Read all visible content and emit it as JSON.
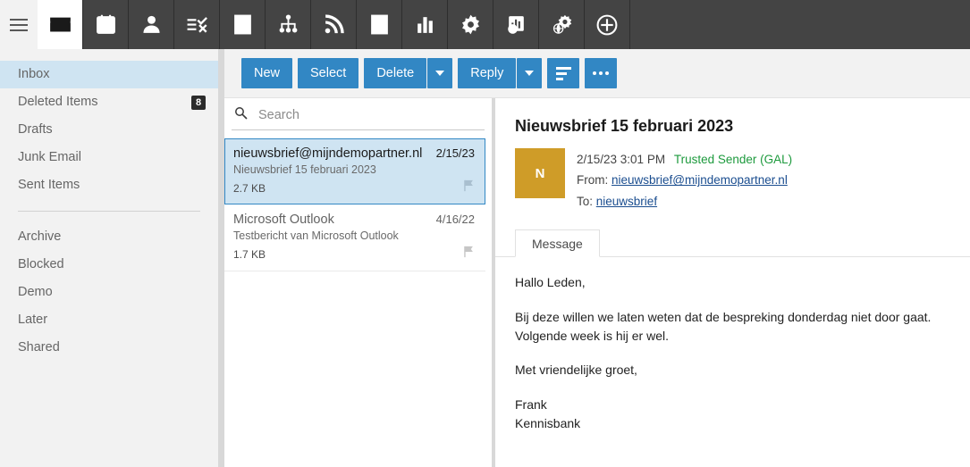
{
  "topnav": {
    "menu_icon": "hamburger-icon",
    "items": [
      {
        "icon": "mail-icon",
        "label": "Mail",
        "active": true
      },
      {
        "icon": "calendar-icon",
        "label": "Calendar",
        "active": false
      },
      {
        "icon": "contacts-icon",
        "label": "Contacts",
        "active": false
      },
      {
        "icon": "tasks-icon",
        "label": "Tasks",
        "active": false
      },
      {
        "icon": "notes-icon",
        "label": "Notes",
        "active": false
      },
      {
        "icon": "org-chart-icon",
        "label": "Organization",
        "active": false
      },
      {
        "icon": "rss-feed-icon",
        "label": "Feeds",
        "active": false
      },
      {
        "icon": "inbox-down-icon",
        "label": "Archive",
        "active": false
      },
      {
        "icon": "bar-chart-icon",
        "label": "Statistics",
        "active": false
      },
      {
        "icon": "gear-icon",
        "label": "Settings",
        "active": false
      },
      {
        "icon": "web-report-icon",
        "label": "Web Reports",
        "active": false
      },
      {
        "icon": "web-gear-icon",
        "label": "Web Settings",
        "active": false
      },
      {
        "icon": "plus-circle-icon",
        "label": "Add",
        "active": false
      }
    ]
  },
  "sidebar": {
    "folders": [
      {
        "label": "Inbox",
        "badge": "",
        "selected": true
      },
      {
        "label": "Deleted Items",
        "badge": "8",
        "selected": false
      },
      {
        "label": "Drafts",
        "badge": "",
        "selected": false
      },
      {
        "label": "Junk Email",
        "badge": "",
        "selected": false
      },
      {
        "label": "Sent Items",
        "badge": "",
        "selected": false
      }
    ],
    "folders2": [
      {
        "label": "Archive",
        "badge": "",
        "selected": false
      },
      {
        "label": "Blocked",
        "badge": "",
        "selected": false
      },
      {
        "label": "Demo",
        "badge": "",
        "selected": false
      },
      {
        "label": "Later",
        "badge": "",
        "selected": false
      },
      {
        "label": "Shared",
        "badge": "",
        "selected": false
      }
    ]
  },
  "toolbar": {
    "new_label": "New",
    "select_label": "Select",
    "delete_label": "Delete",
    "reply_label": "Reply",
    "sort_icon": "sort-icon",
    "more_icon": "ellipsis-icon",
    "accent_color": "#3287c4"
  },
  "search": {
    "placeholder": "Search",
    "value": "",
    "icon": "search-icon"
  },
  "maillist": [
    {
      "from": "nieuwsbrief@mijndemopartner.nl",
      "date": "2/15/23",
      "subject": "Nieuwsbrief 15 februari 2023",
      "size": "2.7 KB",
      "flag": "flag-icon",
      "selected": true
    },
    {
      "from": "Microsoft Outlook",
      "date": "4/16/22",
      "subject": "Testbericht van Microsoft Outlook",
      "size": "1.7 KB",
      "flag": "flag-icon",
      "selected": false
    }
  ],
  "reading": {
    "subject": "Nieuwsbrief 15 februari 2023",
    "avatar_initial": "N",
    "avatar_color": "#cf9c28",
    "datetime": "2/15/23 3:01 PM",
    "trust": "Trusted Sender (GAL)",
    "trust_color": "#1d9a3d",
    "from_label": "From:",
    "from_value": "nieuwsbrief@mijndemopartner.nl",
    "to_label": "To:",
    "to_value": "nieuwsbrief",
    "tab_message": "Message",
    "body": {
      "greeting": "Hallo Leden,",
      "para1_line1": "Bij deze willen we laten weten dat de bespreking donderdag niet door gaat.",
      "para1_line2": "Volgende week is hij er wel.",
      "closing": "Met vriendelijke groet,",
      "sign_name": "Frank",
      "sign_org": "Kennisbank"
    }
  }
}
